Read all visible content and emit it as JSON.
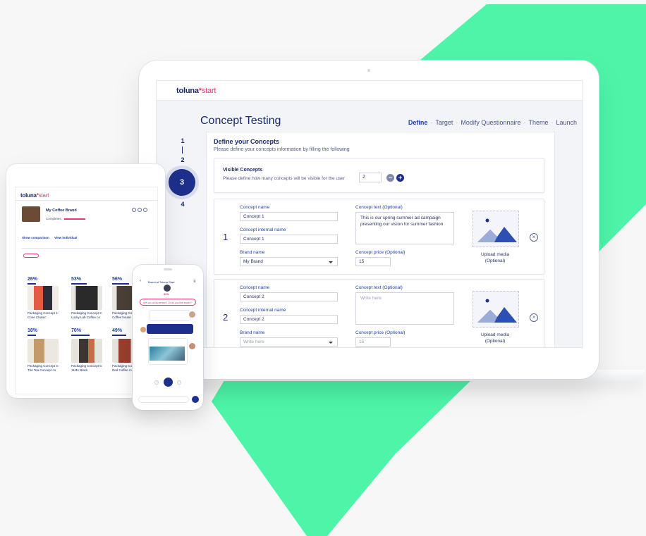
{
  "laptop": {
    "logo": {
      "brand": "toluna",
      "star": "*",
      "product": "start"
    },
    "page_title": "Concept Testing",
    "wizard": [
      {
        "label": "Define",
        "active": true
      },
      {
        "label": "Target",
        "active": false
      },
      {
        "label": "Modify Questionnaire",
        "active": false
      },
      {
        "label": "Theme",
        "active": false
      },
      {
        "label": "Launch",
        "active": false
      }
    ],
    "wizard_separator": "·",
    "steps": [
      "1",
      "2",
      "3",
      "4"
    ],
    "current_step": "3",
    "define": {
      "title": "Define your Concepts",
      "subtitle": "Please define your concepts information by filling the following"
    },
    "visible_concepts": {
      "title": "Visible Concepts",
      "subtitle": "Please define how many concepts will be visible for the user",
      "value": "2",
      "minus": "−",
      "plus": "+"
    },
    "concepts": [
      {
        "number": "1",
        "name_label": "Concept name",
        "name_value": "Concept 1",
        "internal_label": "Concept internal name",
        "internal_value": "Concept 1",
        "brand_label": "Brand name",
        "brand_value": "My Brand",
        "text_label": "Concept text (Optional)",
        "text_value": "This is our spring summer ad campaign presenting our vision for summer fashion",
        "price_label": "Concept price (Optional)",
        "price_value": "15",
        "media_label_1": "Upload media",
        "media_label_2": "(Optional)",
        "remove": "×"
      },
      {
        "number": "2",
        "name_label": "Concept name",
        "name_value": "Concept 2",
        "internal_label": "Concept internal name",
        "internal_value": "Concept 2",
        "brand_label": "Brand name",
        "brand_value": "Write here",
        "text_label": "Concept text (Optional)",
        "text_value": "Write here",
        "price_label": "Concept price (Optional)",
        "price_value": "15",
        "media_label_1": "Upload media",
        "media_label_2": "(Optional)",
        "remove": "×"
      }
    ]
  },
  "tablet": {
    "logo": {
      "brand": "toluna",
      "star": "*",
      "product": "start"
    },
    "product_title": "My Coffee Brand",
    "completion_label": "Completes:",
    "links": [
      "Show comparison",
      "View individual"
    ],
    "percents": [
      "26%",
      "53%",
      "56%",
      "18%",
      "70%",
      "49%"
    ],
    "products": [
      "Packaging Concept 1: Cone Classic",
      "Packaging Concept 2: Lucky Lab Coffee co",
      "Packaging Concept 3: Coffee house",
      "Packaging Concept 4: The Tea Concept co",
      "Packaging Concept 5: 11111 Black",
      "Packaging Concept 6: Red Coffee Co"
    ]
  },
  "phone": {
    "header": "Brand at Toluna Start",
    "percent": "30%",
    "question": "Are you a big person? Or do you like sweet?"
  },
  "colors": {
    "navy": "#1d2f8a",
    "accent_blue": "#1d3fb0",
    "brand_pink": "#e63b6f",
    "mint": "#4cf3a6"
  }
}
